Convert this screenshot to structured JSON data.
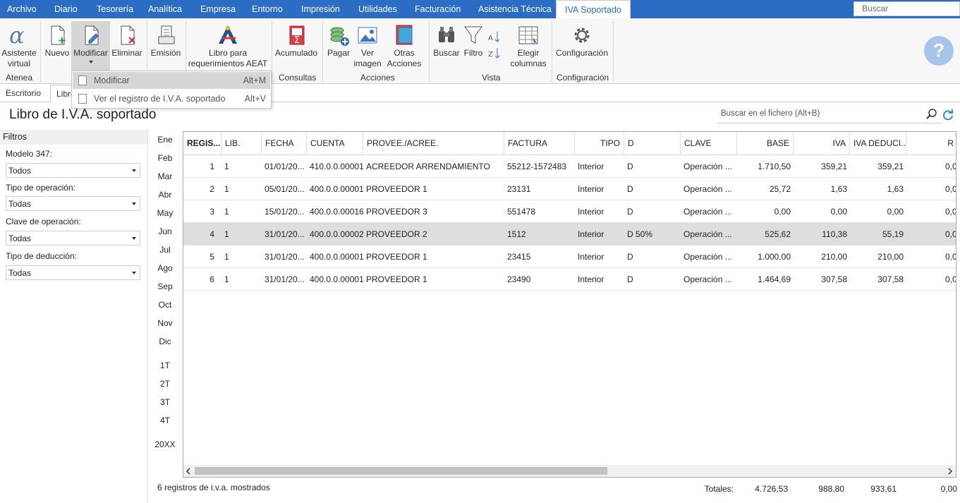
{
  "menu": {
    "items": [
      "Archivo",
      "Diario",
      "Tesorería",
      "Analítica",
      "Empresa",
      "Entorno",
      "Impresión",
      "Utilidades",
      "Facturación",
      "Asistencia Técnica"
    ],
    "active_tab": "IVA Soportado",
    "search_placeholder": "Buscar"
  },
  "ribbon": {
    "asistente": "Asistente virtual",
    "nuevo": "Nuevo",
    "modificar": "Modificar",
    "eliminar": "Eliminar",
    "emision": "Emisión",
    "libro": "Libro para requerimientos AEAT",
    "acumulado": "Acumulado",
    "pagar": "Pagar",
    "ver_imagen": "Ver imagen",
    "otras": "Otras Acciones",
    "buscar": "Buscar",
    "filtro": "Filtro",
    "elegir": "Elegir columnas",
    "configuracion": "Configuración",
    "groups": {
      "atenea": "Atenea",
      "consultas": "Consultas",
      "acciones": "Acciones",
      "vista": "Vista",
      "configuracion": "Configuración"
    },
    "help_icon": "question-icon"
  },
  "tabs": {
    "escritorio": "Escritorio",
    "libro": "Libro"
  },
  "dropdown": {
    "items": [
      {
        "label": "Modificar",
        "shortcut": "Alt+M"
      },
      {
        "label": "Ver el registro de I.V.A. soportado",
        "shortcut": "Alt+V"
      }
    ]
  },
  "page": {
    "title": "Libro de I.V.A. soportado",
    "search_placeholder": "Buscar en el fichero (Alt+B)"
  },
  "filters": {
    "title": "Filtros",
    "modelo_label": "Modelo 347:",
    "modelo_value": "Todos",
    "tipo_op_label": "Tipo de operación:",
    "tipo_op_value": "Todas",
    "clave_label": "Clave de operación:",
    "clave_value": "Todas",
    "tipo_ded_label": "Tipo de deducción:",
    "tipo_ded_value": "Todas"
  },
  "periods": {
    "months": [
      "Ene",
      "Feb",
      "Mar",
      "Abr",
      "May",
      "Jun",
      "Jul",
      "Ago",
      "Sep",
      "Oct",
      "Nov",
      "Dic"
    ],
    "quarters": [
      "1T",
      "2T",
      "3T",
      "4T"
    ],
    "year": "20XX"
  },
  "table": {
    "headers": [
      "REGIS...",
      "LIB.",
      "FECHA",
      "CUENTA",
      "PROVEE./ACREE.",
      "FACTURA",
      "TIPO",
      "D",
      "CLAVE",
      "BASE",
      "IVA",
      "IVA DEDUCI...",
      "R"
    ],
    "rows": [
      [
        "1",
        "1",
        "01/01/20...",
        "410.0.0.00001",
        "ACREEDOR ARRENDAMIENTO",
        "55212-1572483",
        "Interior",
        "D",
        "Operación ...",
        "1.710,50",
        "359,21",
        "359,21",
        "0,0"
      ],
      [
        "2",
        "1",
        "05/01/20...",
        "400.0.0.00001",
        "PROVEEDOR 1",
        "23131",
        "Interior",
        "D",
        "Operación ...",
        "25,72",
        "1,63",
        "1,63",
        "0,0"
      ],
      [
        "3",
        "1",
        "15/01/20...",
        "400.0.0.00016",
        "PROVEEDOR 3",
        "551478",
        "Interior",
        "D",
        "Operación ...",
        "0,00",
        "0,00",
        "0,00",
        "0,0"
      ],
      [
        "4",
        "1",
        "31/01/20...",
        "400.0.0.00002",
        "PROVEEDOR 2",
        "1512",
        "Interior",
        "D 50%",
        "Operación ...",
        "525,62",
        "110,38",
        "55,19",
        "0,0"
      ],
      [
        "5",
        "1",
        "31/01/20...",
        "400.0.0.00001",
        "PROVEEDOR 1",
        "23415",
        "Interior",
        "D",
        "Operación ...",
        "1.000,00",
        "210,00",
        "210,00",
        "0,0"
      ],
      [
        "6",
        "1",
        "31/01/20...",
        "400.0.0.00001",
        "PROVEEDOR 1",
        "23490",
        "Interior",
        "D",
        "Operación ...",
        "1.464,69",
        "307,58",
        "307,58",
        "0,0"
      ]
    ],
    "selected_row": 4
  },
  "footer": {
    "count": "6 registros de i.v.a. mostrados",
    "totales_label": "Totales:",
    "base": "4.726,53",
    "iva": "988,80",
    "iva_ded": "933,61",
    "r": "0,00"
  }
}
